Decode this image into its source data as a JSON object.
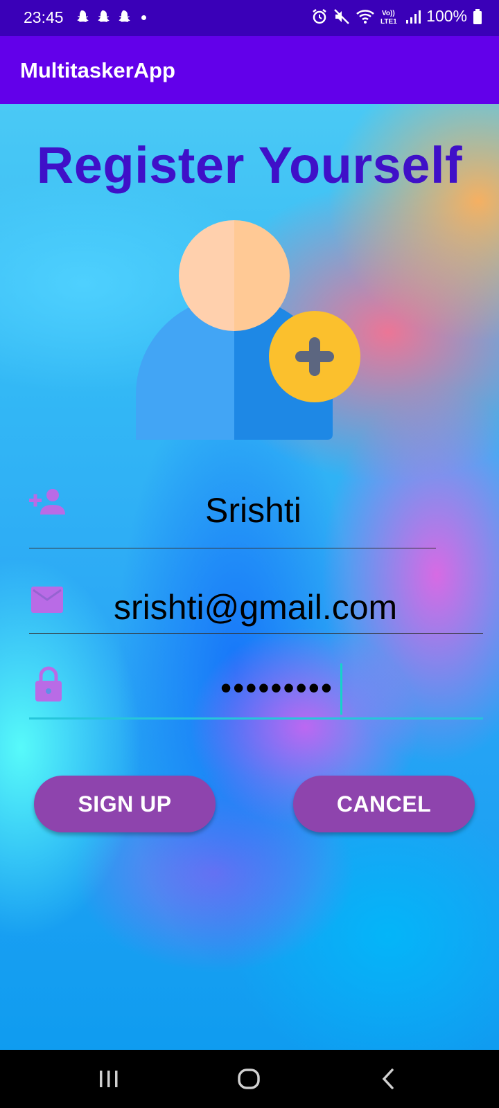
{
  "status_bar": {
    "time": "23:45",
    "battery": "100%",
    "icons": [
      "snapchat-icon",
      "snapchat-icon",
      "snapchat-icon",
      "dot-icon",
      "alarm-icon",
      "mute-icon",
      "wifi-icon",
      "volte-icon",
      "signal-icon",
      "battery-icon"
    ]
  },
  "app_bar": {
    "title": "MultitaskerApp"
  },
  "form": {
    "title": "Register Yourself",
    "name_value": "Srishti",
    "email_value": "srishti@gmail.com",
    "password_value": "•••••••••",
    "signup_label": "SIGN UP",
    "cancel_label": "CANCEL"
  },
  "colors": {
    "status_bar": "#3a00b8",
    "app_bar": "#6200ea",
    "title": "#3f10c8",
    "button": "#8e44ad",
    "field_icon": "#b96be6",
    "focus_line": "#26c6da"
  },
  "nav_bar": {
    "icons": [
      "recents-icon",
      "home-icon",
      "back-icon"
    ]
  }
}
